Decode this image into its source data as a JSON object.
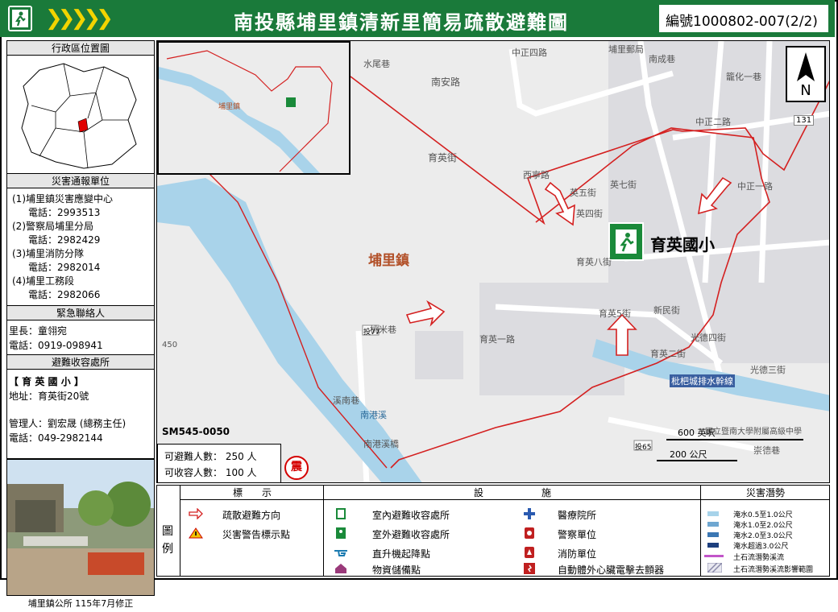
{
  "header": {
    "title": "南投縣埔里鎮清新里簡易疏散避難圖",
    "code": "編號1000802-007(2/2)",
    "chevrons": "❯❯❯❯❯"
  },
  "sidebar": {
    "location_title": "行政區位置圖",
    "report_title": "災害通報單位",
    "report_units": [
      {
        "name": "(1)埔里鎮災害應變中心",
        "phone": "電話：2993513"
      },
      {
        "name": "(2)警察局埔里分局",
        "phone": "電話：2982429"
      },
      {
        "name": "(3)埔里消防分隊",
        "phone": "電話：2982014"
      },
      {
        "name": "(4)埔里工務段",
        "phone": "電話：2982066"
      }
    ],
    "contact_title": "緊急聯絡人",
    "chief": "里長：童翎宛",
    "chief_phone": "電話：0919-098941",
    "shelter_title": "避難收容處所",
    "shelter_name": "【  育  英  國  小  】",
    "shelter_address": "地址：育英街20號",
    "manager": "管理人：劉宏晟 (總務主任)",
    "manager_phone": "電話：049-2982144",
    "photo_caption": "埔里鎮公所 115年7月修正"
  },
  "map": {
    "inset_label": "埔里鎮",
    "town_label": "埔里鎮",
    "school_label": "育英國小",
    "sm_code": "SM545-0050",
    "scale_600": "600 英呎",
    "scale_200": "200 公尺",
    "north": "N",
    "quake": "震",
    "capacity_evac": "可避難人數：  250  人",
    "capacity_shelter": "可收容人數：  100  人",
    "streets": [
      "南安路",
      "中正四路",
      "水尾巷",
      "育英街",
      "西寧路",
      "英七街",
      "英五街",
      "英四街",
      "育英八街",
      "新民街",
      "光德四街",
      "光德三街",
      "育英二街",
      "育英一路",
      "育英5街",
      "中正二路",
      "中正一路",
      "桃米巷",
      "投77",
      "溪南巷",
      "南港溪",
      "南港溪橋",
      "投65",
      "崇德巷",
      "籠化一巷",
      "埔里郵局",
      "南成巷",
      "枇杷城排水幹線",
      "國立暨南大學附屬高級中學"
    ],
    "route_markers": [
      "131",
      "450"
    ]
  },
  "legend": {
    "side_label": "圖例",
    "col1_title": "標　　示",
    "col2_title": "設　　　　　　施",
    "col3_title": "災害潛勢",
    "signs": [
      "疏散避難方向",
      "災害警告標示點"
    ],
    "facilities_left": [
      "室內避難收容處所",
      "室外避難收容處所",
      "直升機起降點",
      "物資儲備點"
    ],
    "facilities_right": [
      "醫療院所",
      "警察單位",
      "消防單位",
      "自動體外心臟電擊去顫器"
    ],
    "hazards": [
      "淹水0.5至1.0公尺",
      "淹水1.0至2.0公尺",
      "淹水2.0至3.0公尺",
      "淹水超過3.0公尺",
      "土石流潛勢溪流",
      "土石流潛勢溪流影響範圍"
    ],
    "hazard_colors": [
      "#a7d3ea",
      "#6fa7d1",
      "#3b77b3",
      "#1d3f7e",
      "#c254c9",
      "#8a8aaa"
    ]
  }
}
